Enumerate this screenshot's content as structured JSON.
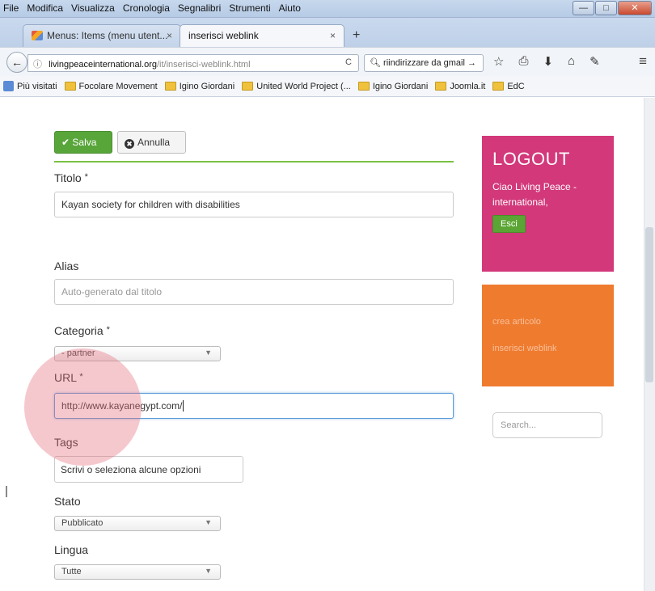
{
  "menu": [
    "File",
    "Modifica",
    "Visualizza",
    "Cronologia",
    "Segnalibri",
    "Strumenti",
    "Aiuto"
  ],
  "window_buttons": {
    "minimize": "—",
    "maximize": "□",
    "close": "✕"
  },
  "tabs": [
    {
      "label": "Menus: Items (menu utent...",
      "close": "×"
    },
    {
      "label": "inserisci weblink",
      "close": "×"
    }
  ],
  "new_tab": "+",
  "nav": {
    "back": "←",
    "info_icon": "ⓘ",
    "url_host": "livingpeaceinternational.org",
    "url_path": "/it/inserisci-weblink.html",
    "reload": "C",
    "search_value": "riindirizzare da gmail",
    "search_arrow": "→",
    "icons": [
      "☆",
      "⎙",
      "⬇",
      "⌂",
      "✎"
    ],
    "menu": "≡"
  },
  "bookmarks": [
    "Più visitati",
    "Focolare Movement",
    "Igino Giordani",
    "United World Project (...",
    "Igino Giordani",
    "Joomla.it",
    "EdC"
  ],
  "form": {
    "save": "Salva",
    "save_check": "✔",
    "cancel": "Annulla",
    "cancel_icon": "✖",
    "title_label": "Titolo",
    "title_value": "Kayan society for children with disabilities",
    "alias_label": "Alias",
    "alias_placeholder": "Auto-generato dal titolo",
    "category_label": "Categoria",
    "category_value": "- partner",
    "url_label": "URL",
    "url_value": "http://www.kayanegypt.com/",
    "tags_label": "Tags",
    "tags_placeholder": "Scrivi o seleziona alcune opzioni",
    "status_label": "Stato",
    "status_value": "Pubblicato",
    "language_label": "Lingua",
    "language_value": "Tutte",
    "required_mark": "*",
    "select_arrow": "▼"
  },
  "sidebar": {
    "logout_title": "LOGOUT",
    "greeting": "Ciao Living Peace - international,",
    "esci": "Esci",
    "links": [
      "crea articolo",
      "inserisci weblink"
    ],
    "search_placeholder": "Search..."
  },
  "colors": {
    "save_green": "#58a53a",
    "logout_pink": "#d2387a",
    "menu_orange": "#ef7b2f",
    "divider_green": "#7ac143"
  }
}
